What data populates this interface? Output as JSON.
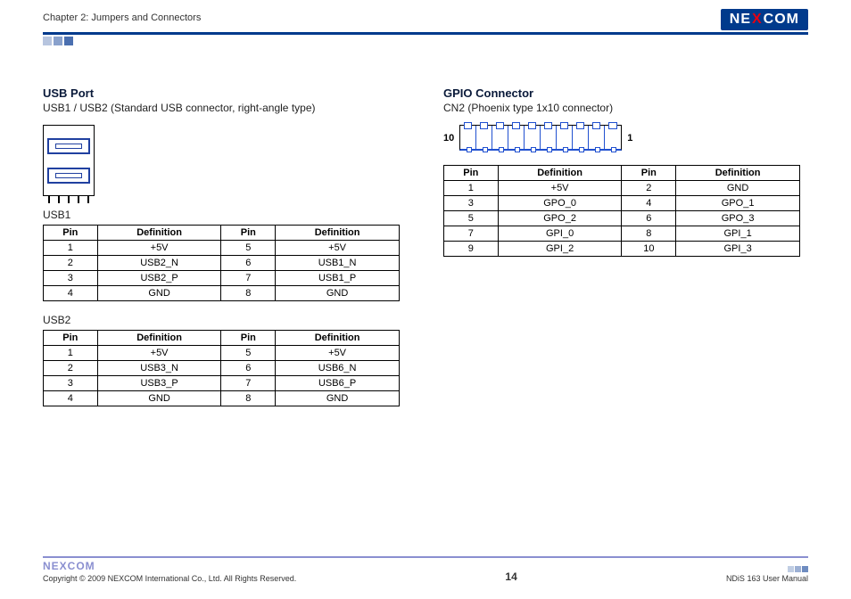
{
  "header": {
    "chapter": "Chapter 2: Jumpers and Connectors",
    "brand_parts": [
      "NE",
      "X",
      "COM"
    ]
  },
  "left": {
    "title": "USB Port",
    "subtitle": "USB1 / USB2 (Standard USB connector, right-angle type)",
    "usb1": {
      "label": "USB1",
      "headers": [
        "Pin",
        "Definition",
        "Pin",
        "Definition"
      ],
      "rows": [
        [
          "1",
          "+5V",
          "5",
          "+5V"
        ],
        [
          "2",
          "USB2_N",
          "6",
          "USB1_N"
        ],
        [
          "3",
          "USB2_P",
          "7",
          "USB1_P"
        ],
        [
          "4",
          "GND",
          "8",
          "GND"
        ]
      ]
    },
    "usb2": {
      "label": "USB2",
      "headers": [
        "Pin",
        "Definition",
        "Pin",
        "Definition"
      ],
      "rows": [
        [
          "1",
          "+5V",
          "5",
          "+5V"
        ],
        [
          "2",
          "USB3_N",
          "6",
          "USB6_N"
        ],
        [
          "3",
          "USB3_P",
          "7",
          "USB6_P"
        ],
        [
          "4",
          "GND",
          "8",
          "GND"
        ]
      ]
    }
  },
  "right": {
    "title": "GPIO Connector",
    "subtitle": "CN2 (Phoenix type 1x10 connector)",
    "pin_labels": {
      "left": "10",
      "right": "1"
    },
    "gpio": {
      "headers": [
        "Pin",
        "Definition",
        "Pin",
        "Definition"
      ],
      "rows": [
        [
          "1",
          "+5V",
          "2",
          "GND"
        ],
        [
          "3",
          "GPO_0",
          "4",
          "GPO_1"
        ],
        [
          "5",
          "GPO_2",
          "6",
          "GPO_3"
        ],
        [
          "7",
          "GPI_0",
          "8",
          "GPI_1"
        ],
        [
          "9",
          "GPI_2",
          "10",
          "GPI_3"
        ]
      ]
    }
  },
  "footer": {
    "brand": "NEXCOM",
    "copyright": "Copyright © 2009 NEXCOM International Co., Ltd. All Rights Reserved.",
    "page": "14",
    "doc": "NDiS 163 User Manual"
  }
}
